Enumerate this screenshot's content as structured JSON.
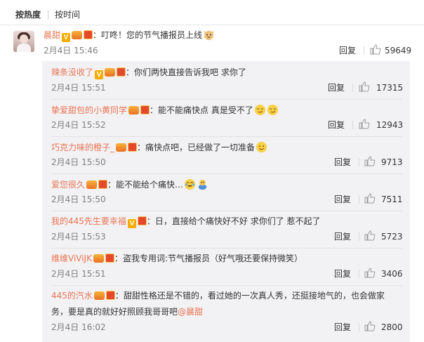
{
  "tabs": [
    {
      "label": "按热度",
      "active": true
    },
    {
      "label": "按时间",
      "active": false
    }
  ],
  "top_comment": {
    "username": "晨甜",
    "text": "：叮咚！您的节气播报员上线",
    "emoji": "cat-face-emoji",
    "time": "2月4日 15:46",
    "reply_label": "回复",
    "likes": "59649"
  },
  "replies": [
    {
      "username": "辣条没收了",
      "text": "：你们两快直接告诉我吧  求你了",
      "time": "2月4日 15:51",
      "reply_label": "回复",
      "likes": "17315",
      "badges": [
        "verified",
        "vip",
        "red"
      ]
    },
    {
      "username": "挚爱甜包的小黄同学",
      "text": "：能不能痛快点 真是受不了",
      "time": "2月4日 15:52",
      "reply_label": "回复",
      "likes": "12943",
      "badges": [
        "vip",
        "red"
      ],
      "emojis": [
        "smirk-emoji",
        "smirk-emoji"
      ]
    },
    {
      "username": "巧克力味的橙子_",
      "text": "：痛快点吧，已经做了一切准备",
      "time": "2月4日 15:50",
      "reply_label": "回复",
      "likes": "9713",
      "badges": [
        "vip",
        "red"
      ],
      "emojis": [
        "smile-emoji"
      ]
    },
    {
      "username": "爱您很久",
      "text": "：能不能给个痛快…",
      "time": "2月4日 15:50",
      "reply_label": "回复",
      "likes": "7511",
      "badges": [
        "vip",
        "red"
      ],
      "emojis": [
        "crying-laugh-emoji",
        "figure-emoji"
      ]
    },
    {
      "username": "我的445先生要幸福",
      "text": "：日，直接给个痛快好不好  求你们了  惹不起了",
      "time": "2月4日 15:53",
      "reply_label": "回复",
      "likes": "5723",
      "badges": [
        "verified",
        "red"
      ]
    },
    {
      "username": "维维ViViJK",
      "text": "：盗我专用词:节气播报员（好气哦还要保持微笑）",
      "time": "2月4日 15:51",
      "reply_label": "回复",
      "likes": "3406",
      "badges": [
        "vip",
        "red"
      ]
    },
    {
      "username": "445的汽水",
      "text_line1": "：甜甜性格还是不错的，看过她的一次真人秀，还挺接地气的，也会做家",
      "text_line2": "务，要是真的就好好照顾我哥哥吧",
      "mention": "@晨甜",
      "time": "2月4日 16:02",
      "reply_label": "回复",
      "likes": "2800",
      "badges": [
        "vip",
        "red"
      ]
    }
  ],
  "colors": {
    "username": "#eb7350",
    "text": "#333333",
    "time": "#808080",
    "reply_bg": "#f2f2f5"
  }
}
